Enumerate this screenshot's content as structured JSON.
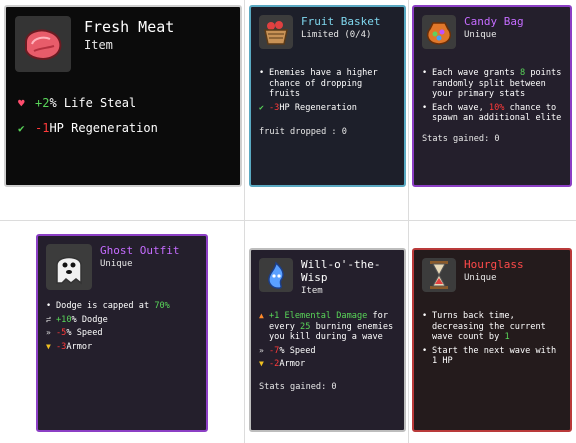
{
  "cards": {
    "fresh_meat": {
      "name": "Fresh Meat",
      "rarity": "Item",
      "stats": [
        {
          "value": "+2",
          "text": " % Life Steal"
        },
        {
          "value": "-1",
          "text": " HP Regeneration"
        }
      ]
    },
    "fruit_basket": {
      "name": "Fruit Basket",
      "rarity": "Limited (0/4)",
      "effect": "Enemies have a higher chance of dropping fruits",
      "stat_value": "-3",
      "stat_text": " HP Regeneration",
      "note": "fruit dropped : 0"
    },
    "candy_bag": {
      "name": "Candy Bag",
      "rarity": "Unique",
      "e1_a": "Each wave grants ",
      "e1_v": "8",
      "e1_b": " points randomly split between your primary stats",
      "e2_a": "Each wave, ",
      "e2_v": "10%",
      "e2_b": " chance to spawn an additional elite",
      "note": "Stats gained: 0"
    },
    "ghost_outfit": {
      "name": "Ghost Outfit",
      "rarity": "Unique",
      "e1_a": "Dodge is capped at ",
      "e1_v": "70%",
      "stats": [
        {
          "value": "+10",
          "text": " % Dodge"
        },
        {
          "value": "-5",
          "text": " % Speed"
        },
        {
          "value": "-3",
          "text": " Armor"
        }
      ]
    },
    "wisp": {
      "name": "Will-o'-the-Wisp",
      "rarity": "Item",
      "e1_v": "+1 Elemental Damage",
      "e1_a": " for every ",
      "e1_n": "25",
      "e1_b": " burning enemies you kill during a wave",
      "stats": [
        {
          "value": "-7",
          "text": " % Speed"
        },
        {
          "value": "-2",
          "text": " Armor"
        }
      ],
      "note": "Stats gained: 0"
    },
    "hourglass": {
      "name": "Hourglass",
      "rarity": "Unique",
      "e1_a": "Turns back time, decreasing the current wave count by ",
      "e1_v": "1",
      "e2": "Start the next wave with 1 HP"
    }
  },
  "colors": {
    "item_name": "#ffffff",
    "limited_name": "#7fd7ee",
    "unique_name": "#c56cff",
    "legendary_name": "#ff4a4a",
    "positive": "#59d659",
    "negative": "#ff3a3a"
  },
  "icons": [
    "meat-icon",
    "basket-icon",
    "candy-bag-icon",
    "ghost-icon",
    "wisp-icon",
    "hourglass-icon",
    "life-steal-icon",
    "regeneration-icon",
    "speed-icon",
    "armor-icon",
    "dodge-icon",
    "fire-icon"
  ]
}
